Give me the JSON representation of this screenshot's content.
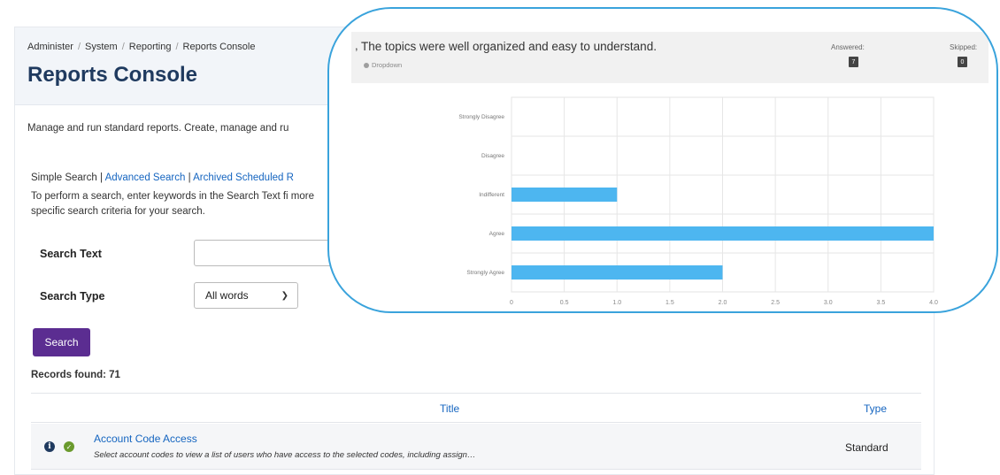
{
  "breadcrumb": [
    "Administer",
    "System",
    "Reporting",
    "Reports Console"
  ],
  "page_title": "Reports Console",
  "description": "Manage and run standard reports. Create, manage and ru",
  "search_modes": {
    "simple": "Simple Search",
    "advanced": "Advanced Search",
    "archived": "Archived Scheduled R"
  },
  "search_help": "To perform a search, enter keywords in the Search Text fi more specific search criteria for your search.",
  "search_text": {
    "label": "Search Text",
    "value": ""
  },
  "search_type": {
    "label": "Search Type",
    "selected": "All words"
  },
  "search_button": "Search",
  "records_found": "Records found: 71",
  "table": {
    "headers": {
      "title": "Title",
      "type": "Type"
    },
    "rows": [
      {
        "title": "Account Code Access",
        "description": "Select account codes to view a list of users who have access to the selected codes, including assign…",
        "type": "Standard"
      }
    ]
  },
  "question": {
    "text": "The topics were well organized and easy to understand.",
    "type": "Dropdown",
    "answered_label": "Answered:",
    "answered_value": "7",
    "skipped_label": "Skipped:",
    "skipped_value": "0"
  },
  "colors": {
    "bar": "#4db6f0",
    "search_button": "#5b2d91",
    "title": "#1f3a5f",
    "link": "#1565c0",
    "bubble_border": "#3aa3dc"
  },
  "chart_data": {
    "type": "bar",
    "orientation": "horizontal",
    "categories": [
      "Strongly Disagree",
      "Disagree",
      "Indifferent",
      "Agree",
      "Strongly Agree"
    ],
    "values": [
      0,
      0,
      1,
      4,
      2
    ],
    "xlim": [
      0,
      4
    ],
    "xticks": [
      "0",
      "0.5",
      "1.0",
      "1.5",
      "2.0",
      "2.5",
      "3.0",
      "3.5",
      "4.0"
    ],
    "grid": true,
    "legend": "none"
  }
}
